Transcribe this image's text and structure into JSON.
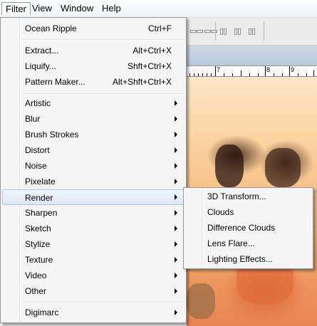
{
  "menubar": {
    "items": [
      "Filter",
      "View",
      "Window",
      "Help"
    ]
  },
  "ruler": {
    "labels": [
      "7",
      "8",
      "9"
    ]
  },
  "filter_menu": {
    "items": [
      {
        "label": "Ocean Ripple",
        "shortcut": "Ctrl+F"
      },
      {
        "label": "Extract...",
        "shortcut": "Alt+Ctrl+X"
      },
      {
        "label": "Liquify...",
        "shortcut": "Shft+Ctrl+X"
      },
      {
        "label": "Pattern Maker...",
        "shortcut": "Alt+Shft+Ctrl+X"
      },
      {
        "label": "Artistic"
      },
      {
        "label": "Blur"
      },
      {
        "label": "Brush Strokes"
      },
      {
        "label": "Distort"
      },
      {
        "label": "Noise"
      },
      {
        "label": "Pixelate"
      },
      {
        "label": "Render"
      },
      {
        "label": "Sharpen"
      },
      {
        "label": "Sketch"
      },
      {
        "label": "Stylize"
      },
      {
        "label": "Texture"
      },
      {
        "label": "Video"
      },
      {
        "label": "Other"
      },
      {
        "label": "Digimarc"
      }
    ]
  },
  "render_submenu": {
    "items": [
      "3D Transform...",
      "Clouds",
      "Difference Clouds",
      "Lens Flare...",
      "Lighting Effects..."
    ]
  },
  "colors": {
    "highlight_border": "#a8c3e3",
    "menu_bg": "#f5f5f5"
  }
}
